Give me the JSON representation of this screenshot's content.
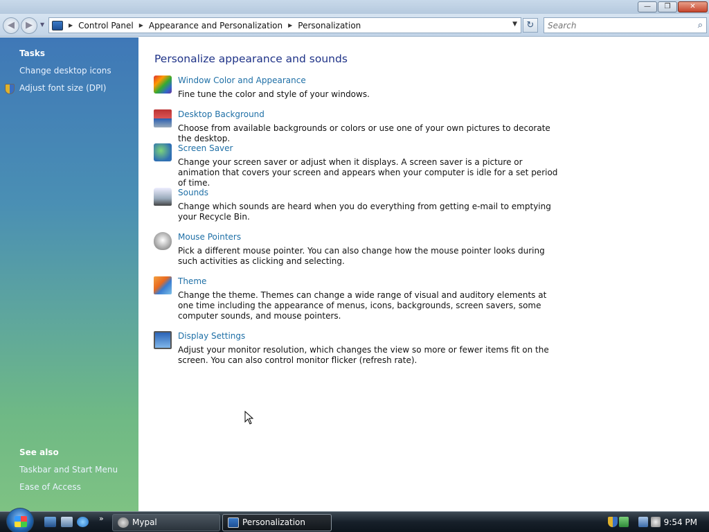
{
  "window": {
    "controls": {
      "minimize": "—",
      "maximize": "❐",
      "close": "✕"
    }
  },
  "navigation": {
    "back": "◀",
    "forward": "▶",
    "breadcrumbs": [
      "Control Panel",
      "Appearance and Personalization",
      "Personalization"
    ],
    "search_placeholder": "Search",
    "refresh": "↻"
  },
  "tasks": {
    "heading": "Tasks",
    "links": [
      "Change desktop icons",
      "Adjust font size (DPI)"
    ]
  },
  "see_also": {
    "heading": "See also",
    "links": [
      "Taskbar and Start Menu",
      "Ease of Access"
    ]
  },
  "main": {
    "title": "Personalize appearance and sounds",
    "items": [
      {
        "link": "Window Color and Appearance",
        "desc": "Fine tune the color and style of your windows.",
        "icon": "window-color-icon"
      },
      {
        "link": "Desktop Background",
        "desc": "Choose from available backgrounds or colors or use one of your own pictures to decorate the desktop.",
        "icon": "desktop-background-icon"
      },
      {
        "link": "Screen Saver",
        "desc": "Change your screen saver or adjust when it displays. A screen saver is a picture or animation that covers your screen and appears when your computer is idle for a set period of time.",
        "icon": "screen-saver-icon"
      },
      {
        "link": "Sounds",
        "desc": "Change which sounds are heard when you do everything from getting e-mail to emptying your Recycle Bin.",
        "icon": "sounds-icon"
      },
      {
        "link": "Mouse Pointers",
        "desc": "Pick a different mouse pointer. You can also change how the mouse pointer looks during such activities as clicking and selecting.",
        "icon": "mouse-pointers-icon"
      },
      {
        "link": "Theme",
        "desc": "Change the theme. Themes can change a wide range of visual and auditory elements at one time including the appearance of menus, icons, backgrounds, screen savers, some computer sounds, and mouse pointers.",
        "icon": "theme-icon"
      },
      {
        "link": "Display Settings",
        "desc": "Adjust your monitor resolution, which changes the view so more or fewer items fit on the screen. You can also control monitor flicker (refresh rate).",
        "icon": "display-settings-icon"
      }
    ]
  },
  "taskbar": {
    "quick_launch_more": "»",
    "buttons": [
      {
        "label": "Mypal",
        "active": false
      },
      {
        "label": "Personalization",
        "active": true
      }
    ],
    "clock": "9:54 PM"
  }
}
